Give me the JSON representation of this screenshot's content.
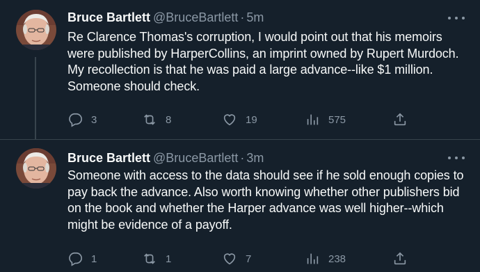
{
  "tweets": [
    {
      "name": "Bruce Bartlett",
      "handle": "@BruceBartlett",
      "separator": "·",
      "time": "5m",
      "text": "Re Clarence Thomas's corruption, I would point out that his memoirs were published by HarperCollins, an imprint owned by Rupert Murdoch. My recollection is that he was paid a large advance--like $1 million. Someone should check.",
      "replies": "3",
      "retweets": "8",
      "likes": "19",
      "views": "575"
    },
    {
      "name": "Bruce Bartlett",
      "handle": "@BruceBartlett",
      "separator": "·",
      "time": "3m",
      "text": "Someone with access to the data should see if he sold enough copies to pay back the advance. Also worth knowing whether other publishers bid on the book and whether the Harper advance was well higher--which might be evidence of a payoff.",
      "replies": "1",
      "retweets": "1",
      "likes": "7",
      "views": "238"
    }
  ],
  "colors": {
    "background": "#15202b",
    "text": "#f7f9f9",
    "secondary": "#8b98a5",
    "divider": "#38444d"
  },
  "icons": [
    "reply-icon",
    "retweet-icon",
    "like-icon",
    "views-icon",
    "share-icon",
    "more-icon"
  ]
}
